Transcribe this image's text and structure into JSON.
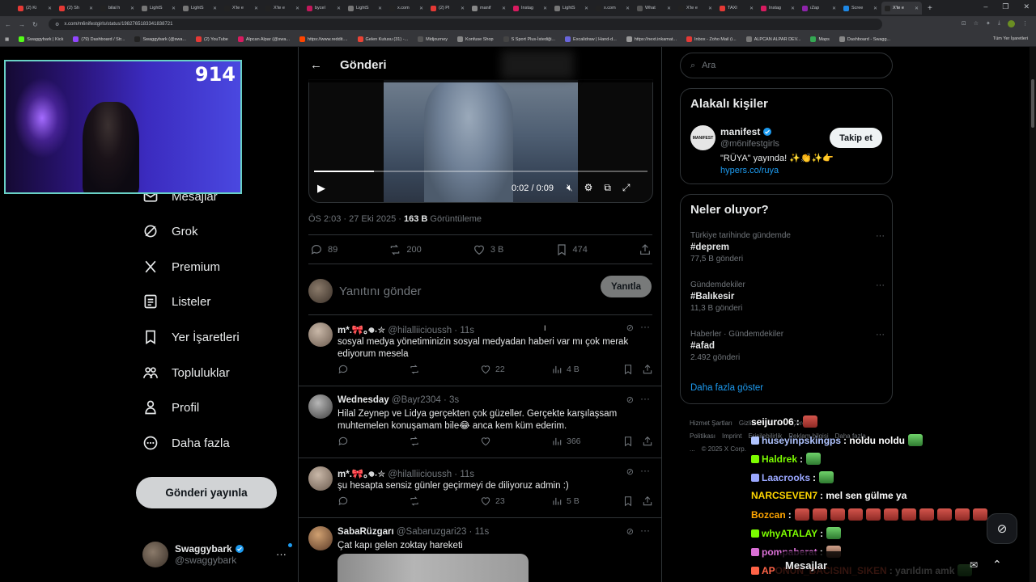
{
  "browser": {
    "tabs": [
      {
        "title": "(2) Ki",
        "color": "#e53935"
      },
      {
        "title": "(2) Sh",
        "color": "#e53935"
      },
      {
        "title": "bilal h",
        "color": "#222222"
      },
      {
        "title": "LightS",
        "color": "#777777"
      },
      {
        "title": "LightS",
        "color": "#777777"
      },
      {
        "title": "X'te e",
        "color": "#222222"
      },
      {
        "title": "X'te e",
        "color": "#222222"
      },
      {
        "title": "bycel",
        "color": "#c2185b"
      },
      {
        "title": "LightS",
        "color": "#777777"
      },
      {
        "title": "x.com",
        "color": "#222222"
      },
      {
        "title": "(2) Pl",
        "color": "#e53935"
      },
      {
        "title": "manif",
        "color": "#888888"
      },
      {
        "title": "Instag",
        "color": "#d81b60"
      },
      {
        "title": "LightS",
        "color": "#777777"
      },
      {
        "title": "x.com",
        "color": "#222222"
      },
      {
        "title": "What",
        "color": "#555555"
      },
      {
        "title": "X'te e",
        "color": "#222222"
      },
      {
        "title": "TAXI",
        "color": "#e53935"
      },
      {
        "title": "Instag",
        "color": "#d81b60"
      },
      {
        "title": "ıZap",
        "color": "#8e24aa"
      },
      {
        "title": "Scree",
        "color": "#1e88e5"
      },
      {
        "title": "X'te e",
        "color": "#222222",
        "active": true
      }
    ],
    "url": "x.com/m6nifestgirls/status/1982765183341838721",
    "bookmarks": [
      {
        "label": "Swaggybark | Kick",
        "color": "#53fc18"
      },
      {
        "label": "(79) Dashboard / Str...",
        "color": "#9146ff"
      },
      {
        "label": "Swaggybark (@swa...",
        "color": "#222222"
      },
      {
        "label": "(2) YouTube",
        "color": "#e53935"
      },
      {
        "label": "Alpcan Alpar (@swa...",
        "color": "#d81b60"
      },
      {
        "label": "https://www.reddit....",
        "color": "#ff4500"
      },
      {
        "label": "Gelen Kutusu (31) -...",
        "color": "#ea4335"
      },
      {
        "label": "Midjourney",
        "color": "#555555"
      },
      {
        "label": "Konfuse Shop",
        "color": "#888888"
      },
      {
        "label": "S Sport Plus-İstediği...",
        "color": "#444444"
      },
      {
        "label": "Excalidraw | Hand-d...",
        "color": "#6965db"
      },
      {
        "label": "https://next.inkamat...",
        "color": "#999999"
      },
      {
        "label": "Inbox - Zoho Mail (i...",
        "color": "#e53935"
      },
      {
        "label": "ALPCAN ALPAR DEV...",
        "color": "#777777"
      },
      {
        "label": "Maps",
        "color": "#34a853"
      },
      {
        "label": "Dashboard - Swagg...",
        "color": "#888888"
      }
    ],
    "bookmarks_all": "Tüm Yer İşaretleri"
  },
  "webcam": {
    "viewer_count": "914"
  },
  "nav": {
    "items": [
      {
        "label": "Mesajlar",
        "icon": "envelope-icon"
      },
      {
        "label": "Grok",
        "icon": "grok-icon"
      },
      {
        "label": "Premium",
        "icon": "x-icon"
      },
      {
        "label": "Listeler",
        "icon": "list-icon"
      },
      {
        "label": "Yer İşaretleri",
        "icon": "bookmark-icon"
      },
      {
        "label": "Topluluklar",
        "icon": "community-icon"
      },
      {
        "label": "Profil",
        "icon": "person-icon"
      },
      {
        "label": "Daha fazla",
        "icon": "more-circle-icon"
      }
    ],
    "post_button": "Gönderi yayınla",
    "account": {
      "name": "Swaggybark",
      "handle": "@swaggybark"
    }
  },
  "post": {
    "header_title": "Gönderi",
    "video": {
      "time": "0:02 / 0:09",
      "progress": 0.18
    },
    "timestamp": "ÖS 2:03 · 27 Eki 2025 · ",
    "views": "163 B",
    "views_label": " Görüntüleme",
    "stats": {
      "replies": "89",
      "reposts": "200",
      "likes": "3 B",
      "bookmarks": "474"
    },
    "reply_placeholder": "Yanıtını gönder",
    "reply_button": "Yanıtla"
  },
  "replies": [
    {
      "name": "m*.🎀｡𖦹˖✮",
      "handle": "@hilalliicioussh · 11s",
      "text": "sosyal medya yönetiminizin sosyal medyadan haberi var mı çok merak ediyorum mesela",
      "likes": "22",
      "views": "4 B"
    },
    {
      "name": "Wednesday",
      "handle": "@Bayr2304 · 3s",
      "text": "Hilal Zeynep ve Lidya gerçekten çok güzeller. Gerçekte karşılaşsam muhtemelen konuşamam bile😂 anca kem küm ederim.",
      "likes": "",
      "views": "366"
    },
    {
      "name": "m*.🎀｡𖦹˖✮",
      "handle": "@hilalliicioussh · 11s",
      "text": "şu hesapta sensiz günler geçirmeyi de diliyoruz admin :)",
      "likes": "23",
      "views": "5 B"
    },
    {
      "name": "SabaRüzgarı",
      "handle": "@Sabaruzgari23 · 11s",
      "text": "Çat kapı gelen zoktay hareketi",
      "likes": "",
      "views": ""
    }
  ],
  "sidebar": {
    "search_placeholder": "Ara",
    "related_title": "Alakalı kişiler",
    "person": {
      "name": "manifest",
      "handle": "@m6nifestgirls",
      "bio": "\"RÜYA\" yayında! ✨👏✨👉",
      "link": "hypers.co/ruya",
      "avatar_text": "MANIFEST",
      "follow": "Takip et"
    },
    "trends_title": "Neler oluyor?",
    "trends": [
      {
        "category": "Türkiye tarihinde gündemde",
        "tag": "#deprem",
        "count": "77,5 B gönderi"
      },
      {
        "category": "Gündemdekiler",
        "tag": "#Balıkesir",
        "count": "11,3 B gönderi"
      },
      {
        "category": "Haberler · Gündemdekiler",
        "tag": "#afad",
        "count": "2.492 gönderi"
      }
    ],
    "show_more": "Daha fazla göster",
    "footer": [
      "Hizmet Şartları",
      "Gizlilik Politikası",
      "Çerez Politikası",
      "Imprint",
      "Erişilebilirlik",
      "Reklam bilgisi",
      "Daha fazla ...",
      "© 2025 X Corp."
    ]
  },
  "chat": [
    {
      "user": "seijuro06",
      "color": "#ffffff",
      "msg": ":",
      "emotes": 1,
      "emote_type": "red"
    },
    {
      "user": "huseyinpskingps",
      "color": "#b0c4ff",
      "msg": ": noldu noldu",
      "emotes": 1,
      "emote_type": "green"
    },
    {
      "user": "Haldrek",
      "color": "#7cfc00",
      "msg": ":",
      "emotes": 1,
      "emote_type": "green"
    },
    {
      "user": "Laacrooks",
      "color": "#9aa7ff",
      "msg": ":",
      "emotes": 1,
      "emote_type": "green"
    },
    {
      "user": "NARCSEVEN7",
      "color": "#ffd700",
      "msg": ": mel sen gülme ya",
      "emotes": 0,
      "emote_type": ""
    },
    {
      "user": "Bozcan",
      "color": "#ffa500",
      "msg": ":",
      "emotes": 11,
      "emote_type": "red"
    },
    {
      "user": "whyATALAY",
      "color": "#7cfc00",
      "msg": ":",
      "emotes": 1,
      "emote_type": "green"
    },
    {
      "user": "pompaberat",
      "color": "#da70d6",
      "msg": ":",
      "emotes": 1,
      "emote_type": "face"
    },
    {
      "user": "APONUN_BACISINI_SIKEN",
      "color": "#ff6347",
      "msg": ": yarıldım amk",
      "emotes": 1,
      "emote_type": "green"
    }
  ],
  "messages_dock": {
    "label": "Mesajlar"
  },
  "colors": {
    "accent": "#1d9bf0",
    "border": "#2f3336",
    "muted": "#71767b"
  }
}
